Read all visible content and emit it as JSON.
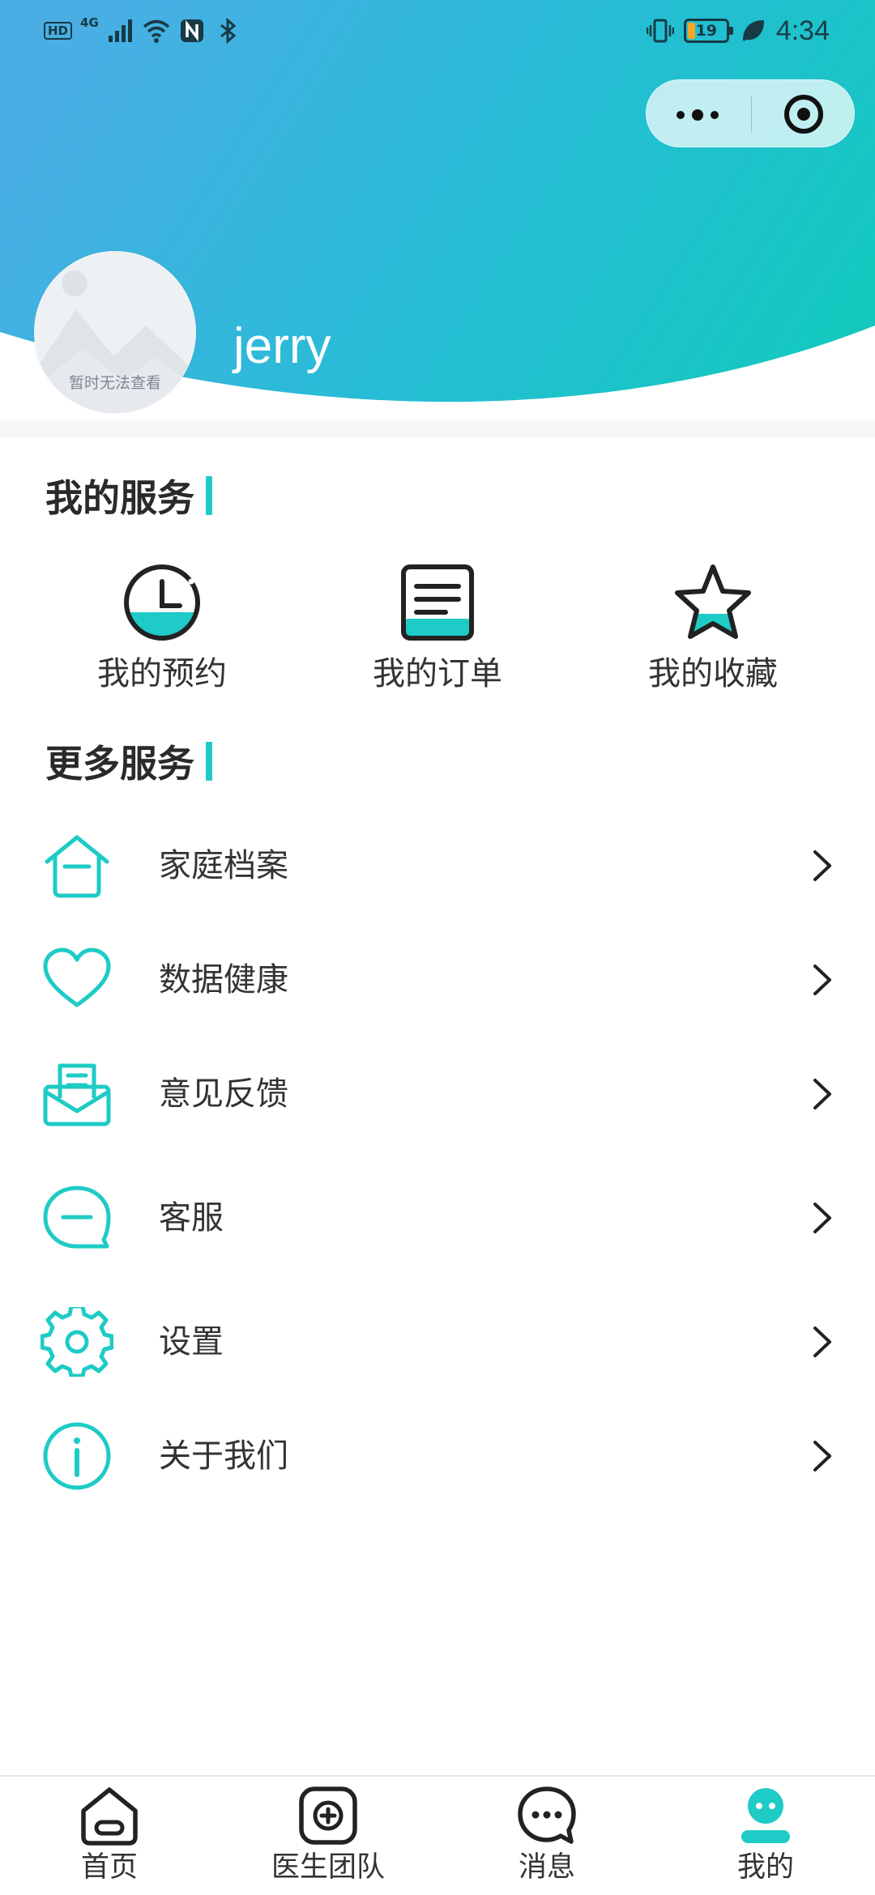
{
  "status_bar": {
    "hd": "HD",
    "network": "4G",
    "battery": "19",
    "battery_level": 0.19,
    "time": "4:34"
  },
  "capsule": {
    "more_icon": "more-dots-icon",
    "close_icon": "target-close-icon"
  },
  "profile": {
    "avatar_caption": "暂时无法查看",
    "username": "jerry"
  },
  "my_services": {
    "title": "我的服务",
    "items": [
      {
        "label": "我的预约",
        "icon": "clock-icon"
      },
      {
        "label": "我的订单",
        "icon": "order-list-icon"
      },
      {
        "label": "我的收藏",
        "icon": "star-icon"
      }
    ]
  },
  "more_services": {
    "title": "更多服务",
    "items": [
      {
        "label": "家庭档案",
        "icon": "house-icon"
      },
      {
        "label": "数据健康",
        "icon": "heart-icon"
      },
      {
        "label": "意见反馈",
        "icon": "feedback-mail-icon"
      },
      {
        "label": "客服",
        "icon": "chat-bubble-icon"
      },
      {
        "label": "设置",
        "icon": "gear-icon"
      },
      {
        "label": "关于我们",
        "icon": "info-icon"
      }
    ]
  },
  "tabbar": {
    "items": [
      {
        "label": "首页",
        "icon": "home-icon",
        "active": false
      },
      {
        "label": "医生团队",
        "icon": "medical-cross-icon",
        "active": false
      },
      {
        "label": "消息",
        "icon": "message-bubble-icon",
        "active": false
      },
      {
        "label": "我的",
        "icon": "profile-icon",
        "active": true
      }
    ]
  },
  "colors": {
    "accent": "#1ecbc6",
    "header_gradient_start": "#4aaee5",
    "header_gradient_end": "#14c8c0",
    "text": "#333333"
  }
}
